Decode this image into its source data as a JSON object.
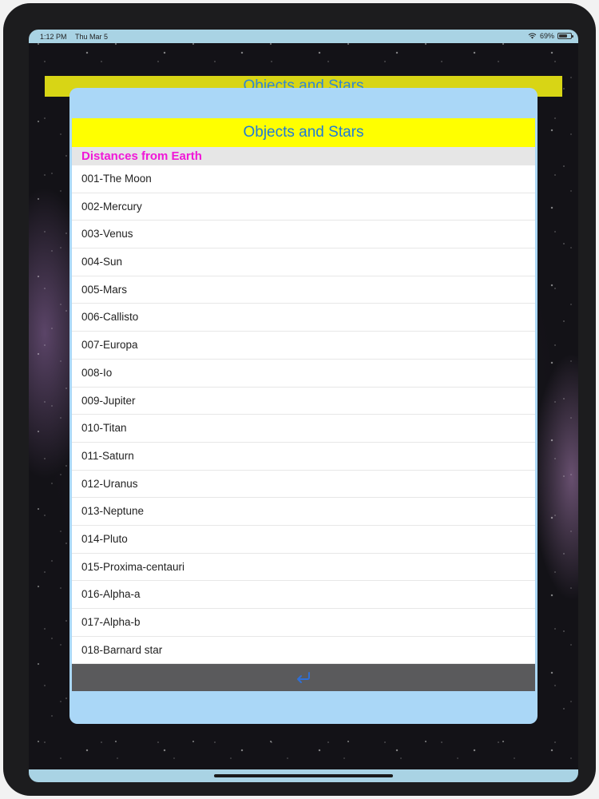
{
  "status_bar": {
    "time": "1:12 PM",
    "date": "Thu Mar 5",
    "battery": "69%",
    "battery_level": 0.69,
    "wifi_icon": "wifi-icon",
    "battery_icon": "battery-icon"
  },
  "background": {
    "title": "Objects and Stars"
  },
  "sheet": {
    "title": "Objects and Stars",
    "section_header": "Distances from Earth",
    "items": [
      {
        "label": "001-The Moon"
      },
      {
        "label": "002-Mercury"
      },
      {
        "label": "003-Venus"
      },
      {
        "label": "004-Sun"
      },
      {
        "label": "005-Mars"
      },
      {
        "label": "006-Callisto"
      },
      {
        "label": "007-Europa"
      },
      {
        "label": "008-Io"
      },
      {
        "label": "009-Jupiter"
      },
      {
        "label": "010-Titan"
      },
      {
        "label": "011-Saturn"
      },
      {
        "label": "012-Uranus"
      },
      {
        "label": "013-Neptune"
      },
      {
        "label": "014-Pluto"
      },
      {
        "label": "015-Proxima-centauri"
      },
      {
        "label": "016-Alpha-a"
      },
      {
        "label": "017-Alpha-b"
      },
      {
        "label": "018-Barnard star"
      }
    ],
    "footer_icon": "return-arrow-icon"
  },
  "colors": {
    "title_bar": "#ffff00",
    "title_text": "#1f7ad8",
    "section_text": "#f018d8",
    "sheet_background": "#aad7f7",
    "footer_bar": "#5a5a5c"
  }
}
